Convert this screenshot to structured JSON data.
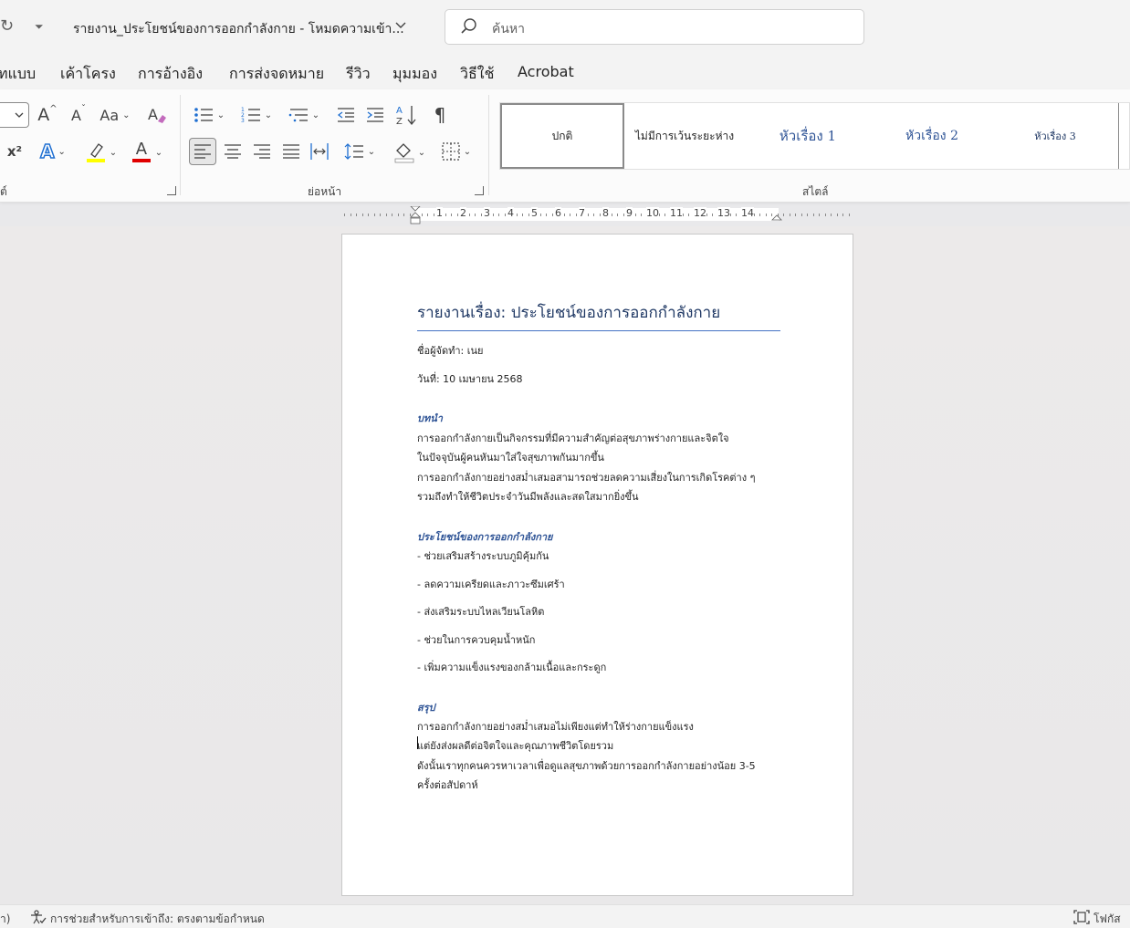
{
  "titlebar": {
    "document_title": "รายงาน_ประโยชน์ของการออกกำลังกาย  -  โหมดความเข้า...",
    "search_placeholder": "ค้นหา"
  },
  "tabs": [
    "ทแบบ",
    "เค้าโครง",
    "การอ้างอิง",
    "การส่งจดหมาย",
    "รีวิว",
    "มุมมอง",
    "วิธีใช้",
    "Acrobat"
  ],
  "ribbon": {
    "groups": {
      "font_label": "ต์",
      "paragraph_label": "ย่อหน้า",
      "styles_label": "สไตล์"
    },
    "font": {
      "grow": "A",
      "shrink": "A",
      "change_case": "Aa",
      "superscript": "x²",
      "text_effects": "A",
      "font_color": "A",
      "highlight_color": "#ffff00",
      "font_color_value": "#e00000"
    },
    "styles": [
      "ปกติ",
      "ไม่มีการเว้นระยะห่าง",
      "หัวเรื่อง 1",
      "หัวเรื่อง 2",
      "หัวเรื่อง 3"
    ]
  },
  "ruler": {
    "numbers": [
      "1",
      "2",
      "3",
      "4",
      "5",
      "6",
      "7",
      "8",
      "9",
      "10",
      "11",
      "12",
      "13",
      "14"
    ]
  },
  "document": {
    "heading": "รายงานเรื่อง: ประโยชน์ของการออกกำลังกาย",
    "author": "ชื่อผู้จัดทำ: เนย",
    "date": "วันที่: 10 เมษายน 2568",
    "intro_title": "บทนำ",
    "intro_lines": [
      "การออกกำลังกายเป็นกิจกรรมที่มีความสำคัญต่อสุขภาพร่างกายและจิตใจ",
      "ในปัจจุบันผู้คนหันมาใส่ใจสุขภาพกันมากขึ้น",
      "การออกกำลังกายอย่างสม่ำเสมอสามารถช่วยลดความเสี่ยงในการเกิดโรคต่าง ๆ",
      "รวมถึงทำให้ชีวิตประจำวันมีพลังและสดใสมากยิ่งขึ้น"
    ],
    "benefits_title": "ประโยชน์ของการออกกำลังกาย",
    "benefits": [
      "- ช่วยเสริมสร้างระบบภูมิคุ้มกัน",
      "- ลดความเครียดและภาวะซึมเศร้า",
      "- ส่งเสริมระบบไหลเวียนโลหิต",
      "- ช่วยในการควบคุมน้ำหนัก",
      "- เพิ่มความแข็งแรงของกล้ามเนื้อและกระดูก"
    ],
    "summary_title": "สรุป",
    "summary_lines": [
      "การออกกำลังกายอย่างสม่ำเสมอไม่เพียงแต่ทำให้ร่างกายแข็งแรง",
      "แต่ยังส่งผลดีต่อจิตใจและคุณภาพชีวิตโดยรวม",
      "ดังนั้นเราทุกคนควรหาเวลาเพื่อดูแลสุขภาพด้วยการออกกำลังกายอย่างน้อย 3-5",
      "ครั้งต่อสัปดาห์"
    ]
  },
  "statusbar": {
    "left_fragment": "า)",
    "accessibility": "การช่วยสำหรับการเข้าถึง: ตรงตามข้อกำหนด",
    "focus": "โฟกัส"
  }
}
